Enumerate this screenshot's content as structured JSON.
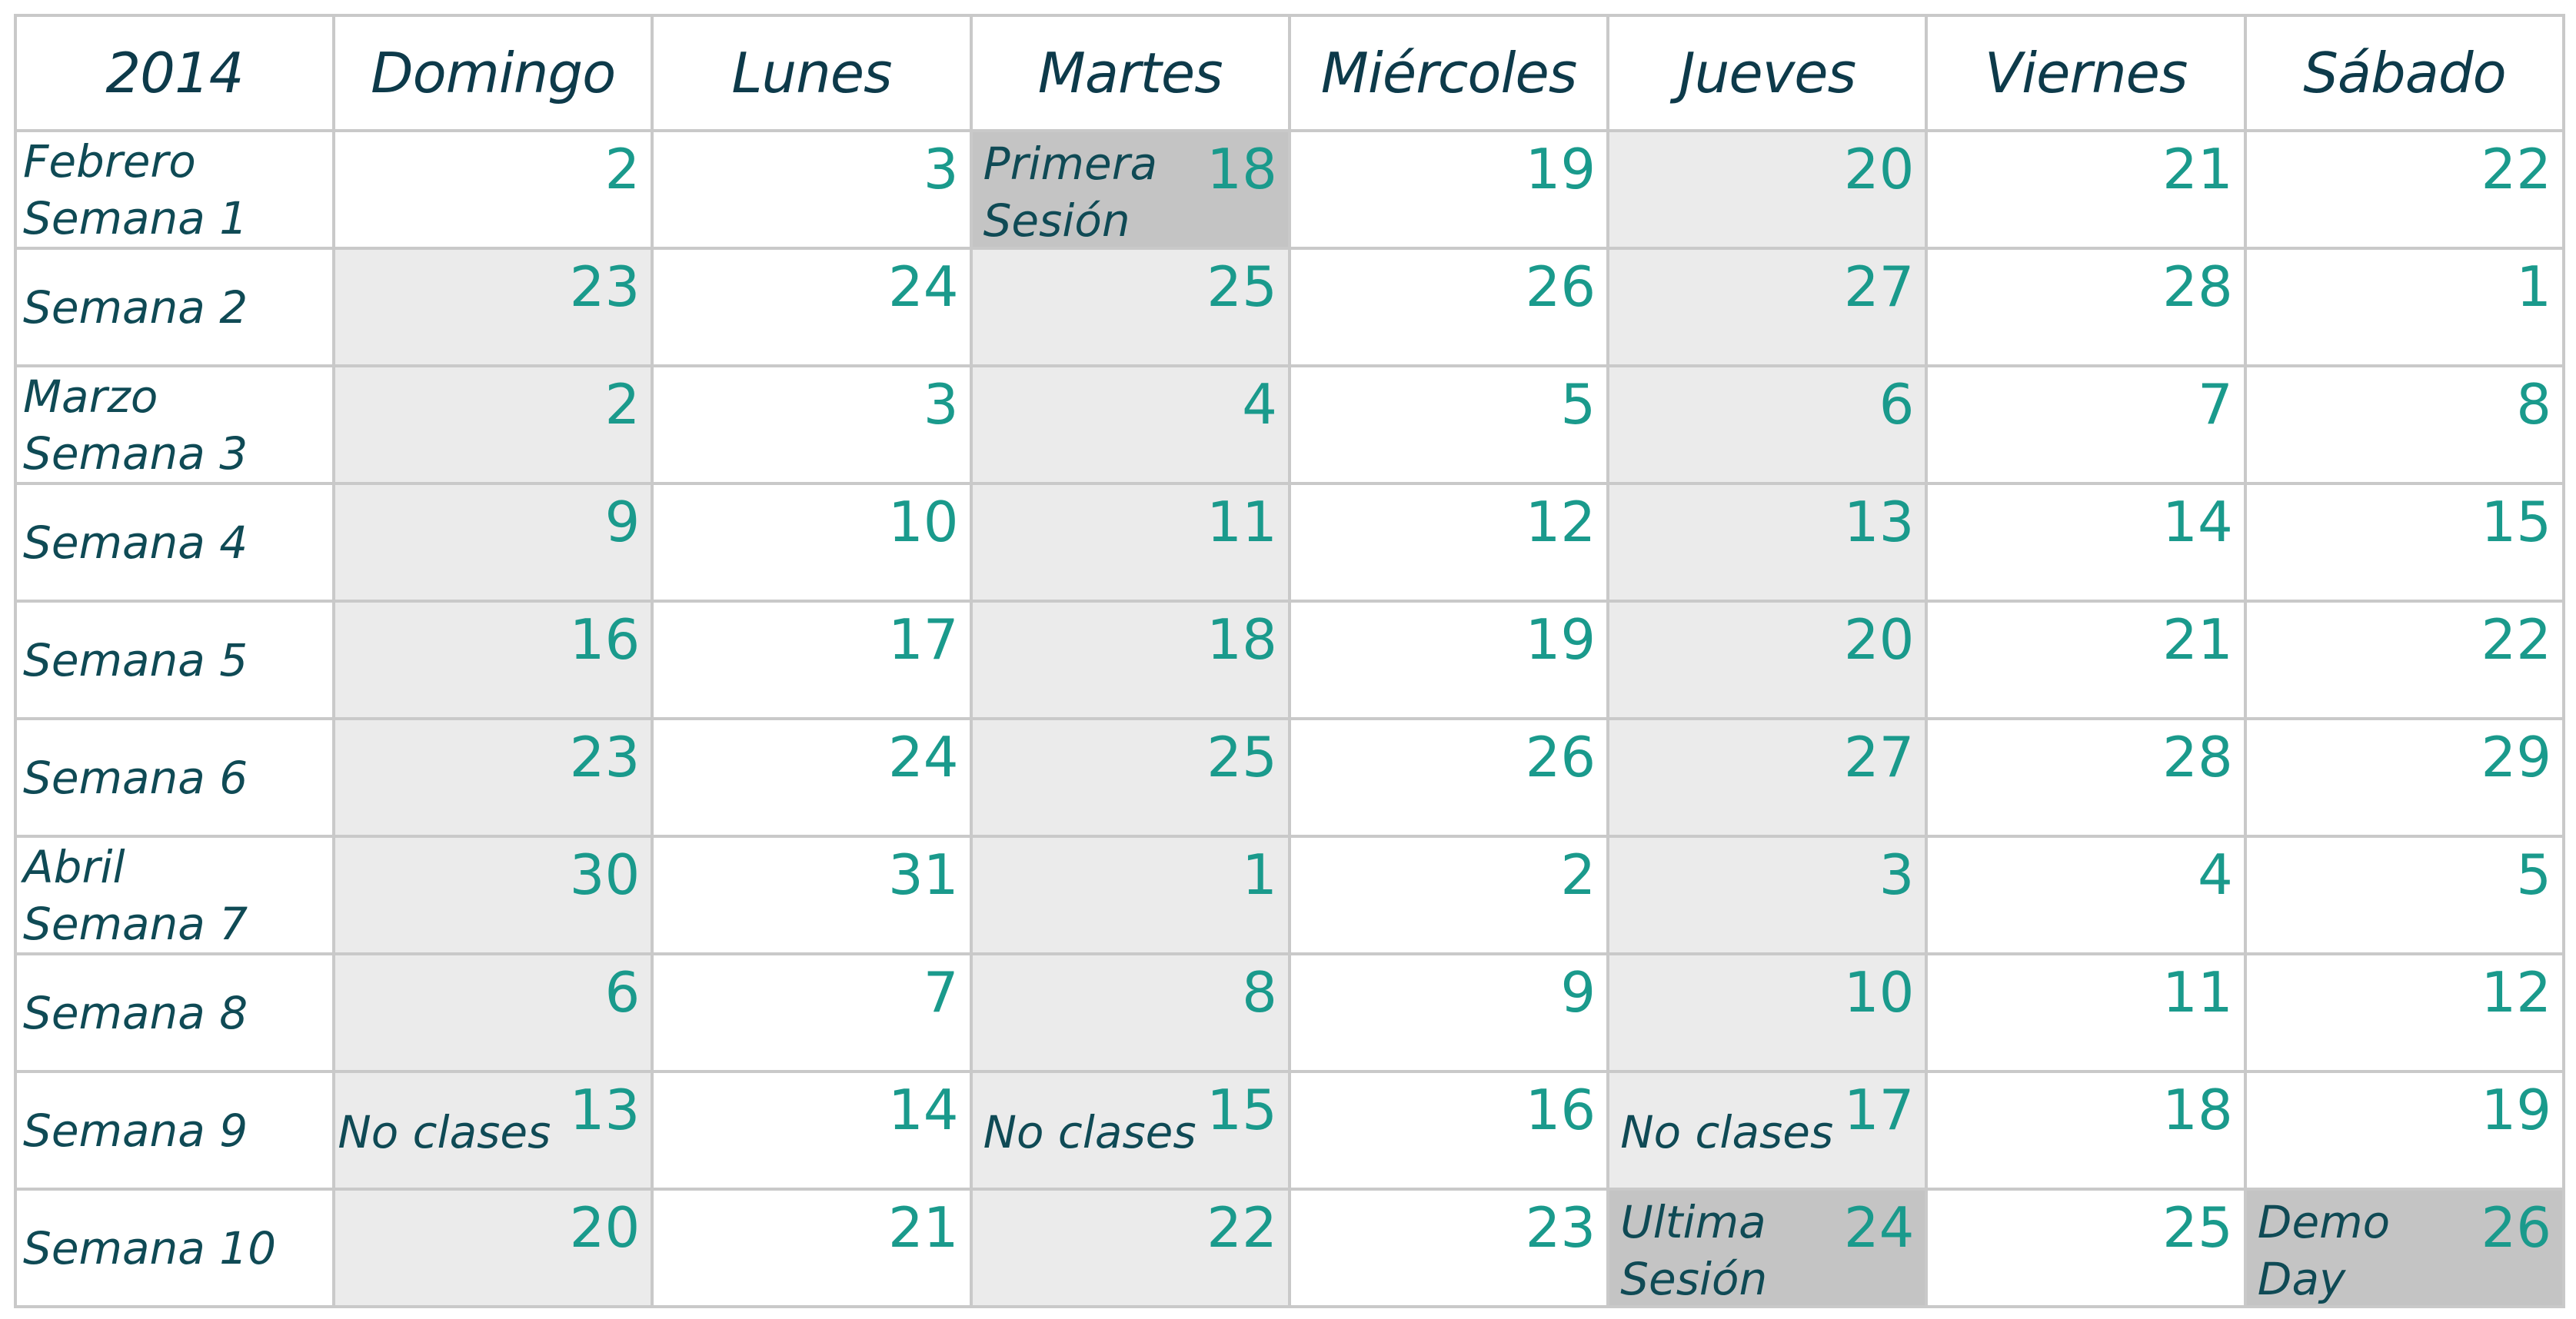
{
  "header": {
    "year": "2014",
    "days": [
      "Domingo",
      "Lunes",
      "Martes",
      "Miércoles",
      "Jueves",
      "Viernes",
      "Sábado"
    ]
  },
  "weeks": [
    {
      "month": "Febrero",
      "label": "Semana 1",
      "cells": [
        {
          "num": "2",
          "shade": "none",
          "note": ""
        },
        {
          "num": "3",
          "shade": "none",
          "note": ""
        },
        {
          "num": "18",
          "shade": "dark",
          "note": "Primera Sesión"
        },
        {
          "num": "19",
          "shade": "none",
          "note": ""
        },
        {
          "num": "20",
          "shade": "light",
          "note": ""
        },
        {
          "num": "21",
          "shade": "none",
          "note": ""
        },
        {
          "num": "22",
          "shade": "none",
          "note": ""
        }
      ]
    },
    {
      "month": "",
      "label": "Semana 2",
      "cells": [
        {
          "num": "23",
          "shade": "light",
          "note": ""
        },
        {
          "num": "24",
          "shade": "none",
          "note": ""
        },
        {
          "num": "25",
          "shade": "light",
          "note": ""
        },
        {
          "num": "26",
          "shade": "none",
          "note": ""
        },
        {
          "num": "27",
          "shade": "light",
          "note": ""
        },
        {
          "num": "28",
          "shade": "none",
          "note": ""
        },
        {
          "num": "1",
          "shade": "none",
          "note": ""
        }
      ]
    },
    {
      "month": "Marzo",
      "label": "Semana 3",
      "cells": [
        {
          "num": "2",
          "shade": "light",
          "note": ""
        },
        {
          "num": "3",
          "shade": "none",
          "note": ""
        },
        {
          "num": "4",
          "shade": "light",
          "note": ""
        },
        {
          "num": "5",
          "shade": "none",
          "note": ""
        },
        {
          "num": "6",
          "shade": "light",
          "note": ""
        },
        {
          "num": "7",
          "shade": "none",
          "note": ""
        },
        {
          "num": "8",
          "shade": "none",
          "note": ""
        }
      ]
    },
    {
      "month": "",
      "label": "Semana 4",
      "cells": [
        {
          "num": "9",
          "shade": "light",
          "note": ""
        },
        {
          "num": "10",
          "shade": "none",
          "note": ""
        },
        {
          "num": "11",
          "shade": "light",
          "note": ""
        },
        {
          "num": "12",
          "shade": "none",
          "note": ""
        },
        {
          "num": "13",
          "shade": "light",
          "note": ""
        },
        {
          "num": "14",
          "shade": "none",
          "note": ""
        },
        {
          "num": "15",
          "shade": "none",
          "note": ""
        }
      ]
    },
    {
      "month": "",
      "label": "Semana 5",
      "cells": [
        {
          "num": "16",
          "shade": "light",
          "note": ""
        },
        {
          "num": "17",
          "shade": "none",
          "note": ""
        },
        {
          "num": "18",
          "shade": "light",
          "note": ""
        },
        {
          "num": "19",
          "shade": "none",
          "note": ""
        },
        {
          "num": "20",
          "shade": "light",
          "note": ""
        },
        {
          "num": "21",
          "shade": "none",
          "note": ""
        },
        {
          "num": "22",
          "shade": "none",
          "note": ""
        }
      ]
    },
    {
      "month": "",
      "label": "Semana 6",
      "cells": [
        {
          "num": "23",
          "shade": "light",
          "note": ""
        },
        {
          "num": "24",
          "shade": "none",
          "note": ""
        },
        {
          "num": "25",
          "shade": "light",
          "note": ""
        },
        {
          "num": "26",
          "shade": "none",
          "note": ""
        },
        {
          "num": "27",
          "shade": "light",
          "note": ""
        },
        {
          "num": "28",
          "shade": "none",
          "note": ""
        },
        {
          "num": "29",
          "shade": "none",
          "note": ""
        }
      ]
    },
    {
      "month": "Abril",
      "label": "Semana 7",
      "cells": [
        {
          "num": "30",
          "shade": "light",
          "note": ""
        },
        {
          "num": "31",
          "shade": "none",
          "note": ""
        },
        {
          "num": "1",
          "shade": "light",
          "note": ""
        },
        {
          "num": "2",
          "shade": "none",
          "note": ""
        },
        {
          "num": "3",
          "shade": "light",
          "note": ""
        },
        {
          "num": "4",
          "shade": "none",
          "note": ""
        },
        {
          "num": "5",
          "shade": "none",
          "note": ""
        }
      ]
    },
    {
      "month": "",
      "label": "Semana 8",
      "cells": [
        {
          "num": "6",
          "shade": "light",
          "note": ""
        },
        {
          "num": "7",
          "shade": "none",
          "note": ""
        },
        {
          "num": "8",
          "shade": "light",
          "note": ""
        },
        {
          "num": "9",
          "shade": "none",
          "note": ""
        },
        {
          "num": "10",
          "shade": "light",
          "note": ""
        },
        {
          "num": "11",
          "shade": "none",
          "note": ""
        },
        {
          "num": "12",
          "shade": "none",
          "note": ""
        }
      ]
    },
    {
      "month": "",
      "label": "Semana 9",
      "cells": [
        {
          "num": "13",
          "shade": "light",
          "note": "No clases",
          "note_style": "right"
        },
        {
          "num": "14",
          "shade": "none",
          "note": ""
        },
        {
          "num": "15",
          "shade": "light",
          "note": "No clases",
          "note_style": "left"
        },
        {
          "num": "16",
          "shade": "none",
          "note": ""
        },
        {
          "num": "17",
          "shade": "light",
          "note": "No clases",
          "note_style": "left"
        },
        {
          "num": "18",
          "shade": "none",
          "note": ""
        },
        {
          "num": "19",
          "shade": "none",
          "note": ""
        }
      ]
    },
    {
      "month": "",
      "label": "Semana 10",
      "cells": [
        {
          "num": "20",
          "shade": "light",
          "note": ""
        },
        {
          "num": "21",
          "shade": "none",
          "note": ""
        },
        {
          "num": "22",
          "shade": "light",
          "note": ""
        },
        {
          "num": "23",
          "shade": "none",
          "note": ""
        },
        {
          "num": "24",
          "shade": "dark",
          "note": "Ultima Sesión"
        },
        {
          "num": "25",
          "shade": "none",
          "note": ""
        },
        {
          "num": "26",
          "shade": "dark",
          "note": "Demo Day"
        }
      ]
    }
  ],
  "colors": {
    "number": "#1a9a8c",
    "text": "#0f4a55",
    "header_text": "#0d3a4a",
    "light_shade": "#ebebeb",
    "dark_shade": "#c4c4c4",
    "border": "#c9c9c9"
  }
}
